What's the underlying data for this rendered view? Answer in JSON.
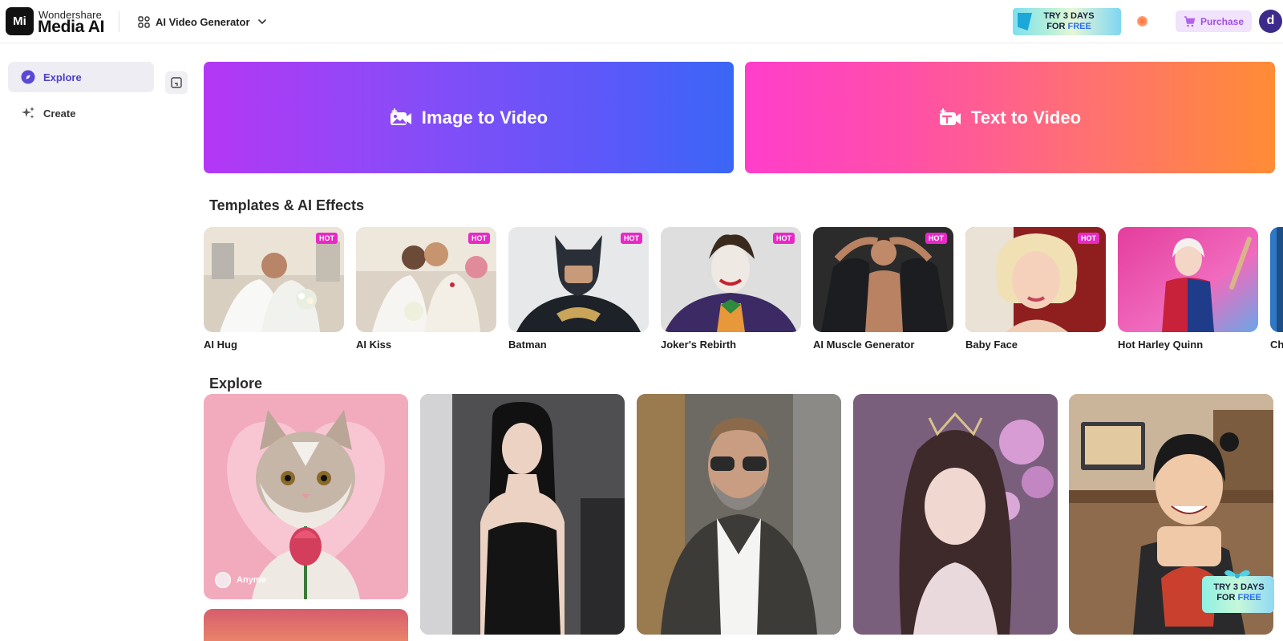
{
  "header": {
    "brand_top": "Wondershare",
    "brand_main": "Media AI",
    "logo_glyph": "Mi",
    "product_switch_label": "AI Video Generator",
    "promo": {
      "line1": "TRY 3 DAYS",
      "line2_prefix": "FOR ",
      "line2_highlight": "FREE"
    },
    "purchase_label": "Purchase",
    "avatar_initial": "d"
  },
  "sidebar": {
    "items": [
      {
        "label": "Explore",
        "icon": "compass-icon",
        "active": true
      },
      {
        "label": "Create",
        "icon": "sparkle-icon",
        "active": false
      }
    ]
  },
  "hero": {
    "image_to_video": "Image to Video",
    "text_to_video": "Text to Video"
  },
  "templates": {
    "title": "Templates & AI Effects",
    "hot_label": "HOT",
    "items": [
      {
        "name": "AI Hug",
        "hot": true
      },
      {
        "name": "AI Kiss",
        "hot": true
      },
      {
        "name": "Batman",
        "hot": true
      },
      {
        "name": "Joker's Rebirth",
        "hot": true
      },
      {
        "name": "AI Muscle Generator",
        "hot": true
      },
      {
        "name": "Baby Face",
        "hot": true
      },
      {
        "name": "Hot Harley Quinn",
        "hot": false
      },
      {
        "name": "Ch",
        "hot": false
      }
    ]
  },
  "explore": {
    "title": "Explore",
    "cards": [
      {
        "author": "Anyme"
      }
    ]
  },
  "floating_promo": {
    "line1": "TRY 3 DAYS",
    "line2_prefix": "FOR ",
    "line2_highlight": "FREE"
  },
  "colors": {
    "accent": "#4e3fc9",
    "hot_badge": "#e829c6",
    "purchase_text": "#a24ee6"
  }
}
